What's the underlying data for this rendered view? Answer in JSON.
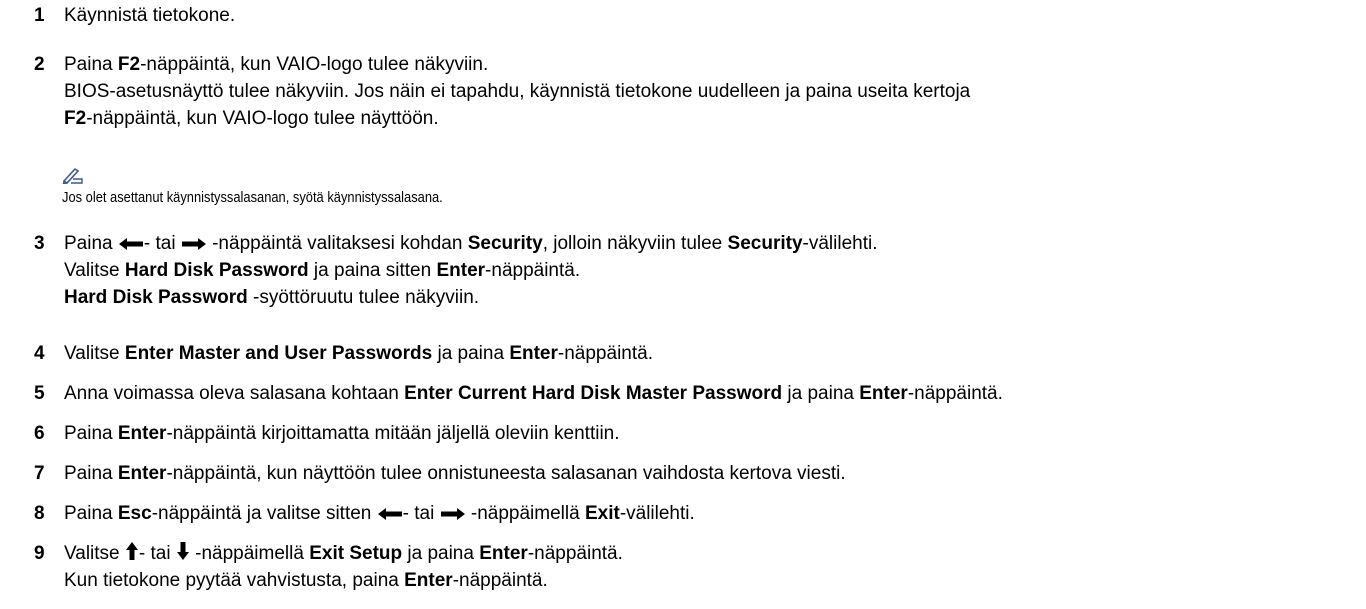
{
  "steps": [
    {
      "num": "1",
      "l1": "Käynnistä tietokone."
    },
    {
      "num": "2",
      "l1a": "Paina ",
      "l1b": "F2",
      "l1c": "-näppäintä, kun VAIO-logo tulee näkyviin.",
      "l2": "BIOS-asetusnäyttö tulee näkyviin. Jos näin ei tapahdu, käynnistä tietokone uudelleen ja paina useita kertoja",
      "l3a": "F2",
      "l3b": "-näppäintä, kun VAIO-logo tulee näyttöön."
    },
    {
      "num": "3",
      "l1a": "Paina ",
      "l1b": "- tai ",
      "l1c": " -näppäintä valitaksesi kohdan ",
      "l1d": "Security",
      "l1e": ", jolloin näkyviin tulee ",
      "l1f": "Security",
      "l1g": "-välilehti.",
      "l2a": "Valitse ",
      "l2b": "Hard Disk Password",
      "l2c": " ja paina sitten ",
      "l2d": "Enter",
      "l2e": "-näppäintä.",
      "l3a": "Hard Disk Password",
      "l3b": " -syöttöruutu tulee näkyviin."
    },
    {
      "num": "4",
      "l1a": "Valitse ",
      "l1b": "Enter Master and User Passwords",
      "l1c": " ja paina ",
      "l1d": "Enter",
      "l1e": "-näppäintä."
    },
    {
      "num": "5",
      "l1a": "Anna voimassa oleva salasana kohtaan ",
      "l1b": "Enter Current Hard Disk Master Password",
      "l1c": " ja paina ",
      "l1d": "Enter",
      "l1e": "-näppäintä."
    },
    {
      "num": "6",
      "l1a": "Paina ",
      "l1b": "Enter",
      "l1c": "-näppäintä kirjoittamatta mitään jäljellä oleviin kenttiin."
    },
    {
      "num": "7",
      "l1a": "Paina ",
      "l1b": "Enter",
      "l1c": "-näppäintä, kun näyttöön tulee onnistuneesta salasanan vaihdosta kertova viesti."
    },
    {
      "num": "8",
      "l1a": "Paina ",
      "l1b": "Esc",
      "l1c": "-näppäintä ja valitse sitten ",
      "l1d": "- tai ",
      "l1e": " -näppäimellä ",
      "l1f": "Exit",
      "l1g": "-välilehti."
    },
    {
      "num": "9",
      "l1a": "Valitse ",
      "l1b": "- tai ",
      "l1c": " -näppäimellä ",
      "l1d": "Exit Setup",
      "l1e": " ja paina ",
      "l1f": "Enter",
      "l1g": "-näppäintä.",
      "l2a": "Kun tietokone pyytää vahvistusta, paina ",
      "l2b": "Enter",
      "l2c": "-näppäintä."
    }
  ],
  "note": {
    "icon": "pencil-note-icon",
    "text": "Jos olet asettanut käynnistyssalasanan, syötä käynnistyssalasana."
  },
  "colors": {
    "text": "#000000",
    "note_icon": "#3a5a8c"
  }
}
